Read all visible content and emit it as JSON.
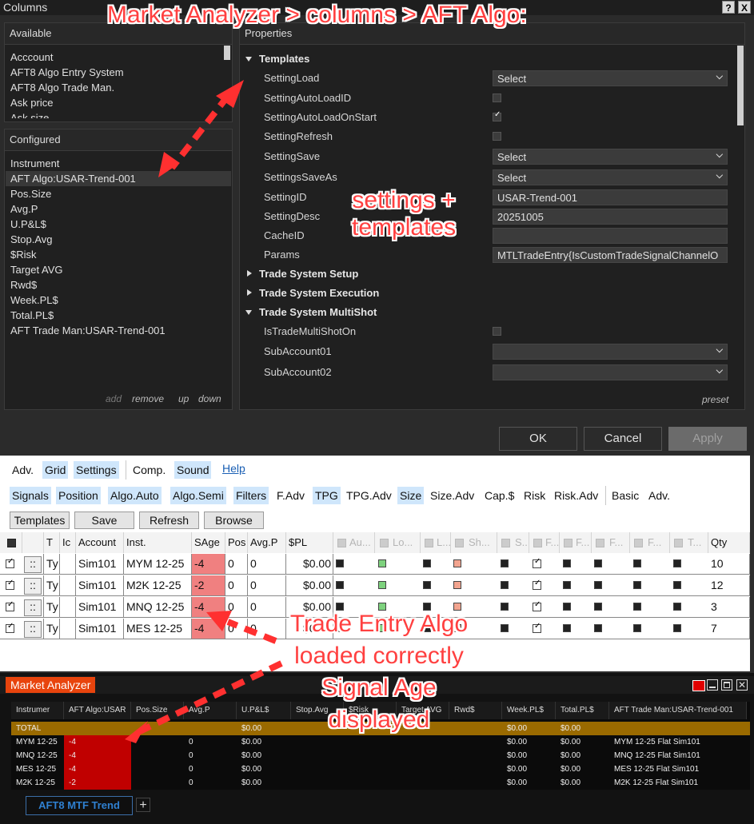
{
  "dialog": {
    "title": "Columns",
    "help_btn": "?",
    "close_btn": "X",
    "available": {
      "header": "Available",
      "items": [
        "Acccount",
        "AFT8 Algo Entry System",
        "AFT8 Algo Trade Man.",
        "Ask price",
        "Ask size"
      ]
    },
    "configured": {
      "header": "Configured",
      "items": [
        "Instrument",
        "AFT Algo:USAR-Trend-001",
        "Pos.Size",
        "Avg.P",
        "U.P&L$",
        "Stop.Avg",
        "$Risk",
        "Target AVG",
        "Rwd$",
        "Week.PL$",
        "Total.PL$",
        "AFT Trade Man:USAR-Trend-001"
      ],
      "actions": {
        "add": "add",
        "remove": "remove",
        "up": "up",
        "down": "down"
      }
    },
    "properties": {
      "header": "Properties",
      "templates_category": "Templates",
      "rows": {
        "setting_load": {
          "name": "SettingLoad",
          "value": "Select"
        },
        "setting_auto_load_id": {
          "name": "SettingAutoLoadID"
        },
        "setting_auto_load_on_start": {
          "name": "SettingAutoLoadOnStart"
        },
        "setting_refresh": {
          "name": "SettingRefresh"
        },
        "setting_save": {
          "name": "SettingSave",
          "value": "Select"
        },
        "settings_save_as": {
          "name": "SettingsSaveAs",
          "value": "Select"
        },
        "setting_id": {
          "name": "SettingID",
          "value": "USAR-Trend-001"
        },
        "setting_desc": {
          "name": "SettingDesc",
          "value": "20251005"
        },
        "cache_id": {
          "name": "CacheID",
          "value": ""
        },
        "params": {
          "name": "Params",
          "value": "MTLTradeEntry{IsCustomTradeSignalChannelO"
        }
      },
      "cat_setup": "Trade System Setup",
      "cat_execution": "Trade System Execution",
      "cat_multishot": "Trade System MultiShot",
      "multishot_rows": {
        "is_trade_multishot_on": {
          "name": "IsTradeMultiShotOn"
        },
        "subaccount01": {
          "name": "SubAccount01",
          "value": ""
        },
        "subaccount02": {
          "name": "SubAccount02",
          "value": ""
        }
      },
      "preset": "preset"
    },
    "buttons": {
      "ok": "OK",
      "cancel": "Cancel",
      "apply": "Apply"
    }
  },
  "toolbar": {
    "row1": [
      "Adv.",
      "Grid",
      "Settings",
      "Comp.",
      "Sound",
      "Help"
    ],
    "row2": [
      "Signals",
      "Position",
      "Algo.Auto",
      "Algo.Semi",
      "Filters",
      "F.Adv",
      "TPG",
      "TPG.Adv",
      "Size",
      "Size.Adv",
      "Cap.$",
      "Risk",
      "Risk.Adv",
      "Basic",
      "Adv."
    ],
    "row3": [
      "Templates",
      "Save",
      "Refresh",
      "Browse"
    ]
  },
  "grid": {
    "headers": [
      "T",
      "Ic",
      "Account",
      "Inst.",
      "SAge",
      "Pos",
      "Avg.P",
      "$PL",
      "Au...",
      "Lo...",
      "L...",
      "Sh...",
      "S...",
      "F...",
      "F...",
      "F...",
      "F...",
      "T...",
      "Qty"
    ],
    "rows": [
      {
        "drag": "::",
        "t": "Ty",
        "account": "Sim101",
        "inst": "MYM 12-25",
        "sage": "-4",
        "pos": "0",
        "avgp": "0",
        "pl": "$0.00",
        "qty": "10"
      },
      {
        "drag": "::",
        "t": "Ty",
        "account": "Sim101",
        "inst": "M2K 12-25",
        "sage": "-2",
        "pos": "0",
        "avgp": "0",
        "pl": "$0.00",
        "qty": "12"
      },
      {
        "drag": "::",
        "t": "Ty",
        "account": "Sim101",
        "inst": "MNQ 12-25",
        "sage": "-4",
        "pos": "0",
        "avgp": "0",
        "pl": "$0.00",
        "qty": "3"
      },
      {
        "drag": "::",
        "t": "Ty",
        "account": "Sim101",
        "inst": "MES 12-25",
        "sage": "-4",
        "pos": "0",
        "avgp": "0",
        "pl": "$0.00",
        "qty": "7"
      }
    ]
  },
  "market_analyzer": {
    "title": "Market Analyzer",
    "headers": [
      "Instrumer",
      "AFT Algo:USAR",
      "Pos.Size",
      "Avg.P",
      "U.P&L$",
      "Stop.Avg",
      "$Risk",
      "Target AVG",
      "Rwd$",
      "Week.PL$",
      "Total.PL$",
      "AFT Trade Man:USAR-Trend-001"
    ],
    "total_row": {
      "label": "TOTAL",
      "upl": "$0.00",
      "week": "$0.00",
      "total": "$0.00"
    },
    "rows": [
      {
        "inst": "MYM 12-25",
        "algo": "-4",
        "avgp": "0",
        "upl": "$0.00",
        "week": "$0.00",
        "total": "$0.00",
        "tm": "MYM 12-25 Flat Sim101"
      },
      {
        "inst": "MNQ 12-25",
        "algo": "-4",
        "avgp": "0",
        "upl": "$0.00",
        "week": "$0.00",
        "total": "$0.00",
        "tm": "MNQ 12-25 Flat Sim101"
      },
      {
        "inst": "MES 12-25",
        "algo": "-4",
        "avgp": "0",
        "upl": "$0.00",
        "week": "$0.00",
        "total": "$0.00",
        "tm": "MES 12-25 Flat Sim101"
      },
      {
        "inst": "M2K 12-25",
        "algo": "-2",
        "avgp": "0",
        "upl": "$0.00",
        "week": "$0.00",
        "total": "$0.00",
        "tm": "M2K 12-25 Flat Sim101"
      }
    ],
    "tab": "AFT8 MTF Trend",
    "add_tab": "+"
  },
  "annotations": {
    "top": "Market Analyzer > columns > AFT Algo:",
    "mid_line1": "settings +",
    "mid_line2": "templates",
    "bottom_line1": "Trade Entry Algo",
    "bottom_line2": "loaded correctly",
    "bottom_line3": "Signal Age",
    "bottom_line4": "displayed"
  },
  "colors": {
    "accent_red": "#ff4040",
    "sage_bg": "#f08080",
    "ma_red": "#c00000",
    "total_bg": "#9a6a00"
  }
}
